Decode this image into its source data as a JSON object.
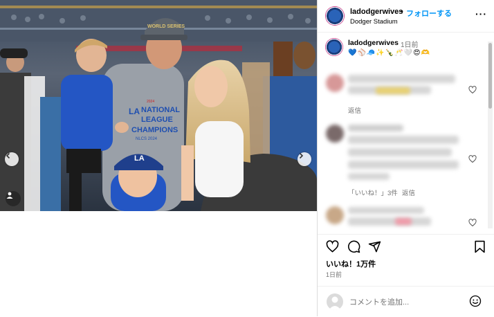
{
  "post": {
    "username": "ladodgerwives",
    "separator": "•",
    "follow_label": "フォローする",
    "location": "Dodger Stadium",
    "more_label": "···"
  },
  "photo": {
    "cap_text": "WORLD SERIES",
    "shirt_lines": [
      "NATIONAL",
      "LEAGUE",
      "CHAMPIONS"
    ],
    "shirt_year": "2024",
    "shirt_sub": "NLCS 2024",
    "kid_cap_logo": "LA",
    "shirt_logo": "LA"
  },
  "caption": {
    "username": "ladodgerwives",
    "time": "1日前",
    "emoji_line": "💙⚾🧢✨🍾🥂🤍😍🫶"
  },
  "comments": [
    {
      "reply_label": "返信"
    },
    {
      "likes_label": "「いいね！」3件",
      "reply_label": "返信"
    }
  ],
  "actions": {
    "likes": "いいね！1万件",
    "date": "1日前"
  },
  "comment_input": {
    "placeholder": "コメントを追加..."
  },
  "colors": {
    "accent": "#0095f6",
    "dodger_blue": "#1f4fb0",
    "muted": "#737373"
  }
}
